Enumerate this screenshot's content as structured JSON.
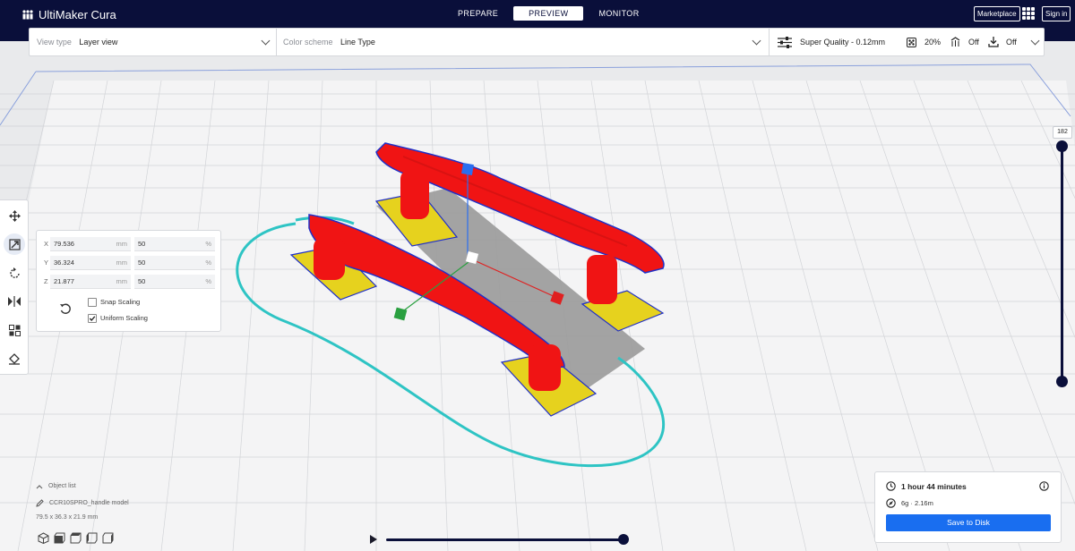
{
  "app": {
    "brand": "UltiMaker Cura",
    "stages": [
      "PREPARE",
      "PREVIEW",
      "MONITOR"
    ],
    "active_stage": "PREVIEW",
    "marketplace_label": "Marketplace",
    "signin_label": "Sign in"
  },
  "settings_bar": {
    "view_type_label": "View type",
    "view_type_value": "Layer view",
    "color_scheme_label": "Color scheme",
    "color_scheme_value": "Line Type",
    "profile": "Super Quality - 0.12mm",
    "infill": "20%",
    "support": "Off",
    "adhesion": "Off"
  },
  "scale_panel": {
    "rows": [
      {
        "axis": "X",
        "mm": "79.536",
        "pct": "50"
      },
      {
        "axis": "Y",
        "mm": "36.324",
        "pct": "50"
      },
      {
        "axis": "Z",
        "mm": "21.877",
        "pct": "50"
      }
    ],
    "mm_unit": "mm",
    "pct_unit": "%",
    "snap_scaling_label": "Snap Scaling",
    "snap_scaling_checked": false,
    "uniform_scaling_label": "Uniform Scaling",
    "uniform_scaling_checked": true
  },
  "object_info": {
    "list_label": "Object list",
    "name": "CCR10SPRO_handle model",
    "dimensions": "79.5 x 36.3 x 21.9 mm"
  },
  "layer_slider": {
    "current_layer": "182"
  },
  "print_info": {
    "time": "1 hour 44 minutes",
    "material": "6g · 2.16m",
    "save_label": "Save to Disk"
  },
  "colors": {
    "header_bg": "#0a0f3a",
    "accent": "#196ef0",
    "wall_red": "#f01414",
    "infill_yellow": "#e6d21e",
    "skirt_cyan": "#2ec4c4",
    "shell_blue": "#2030c8"
  }
}
